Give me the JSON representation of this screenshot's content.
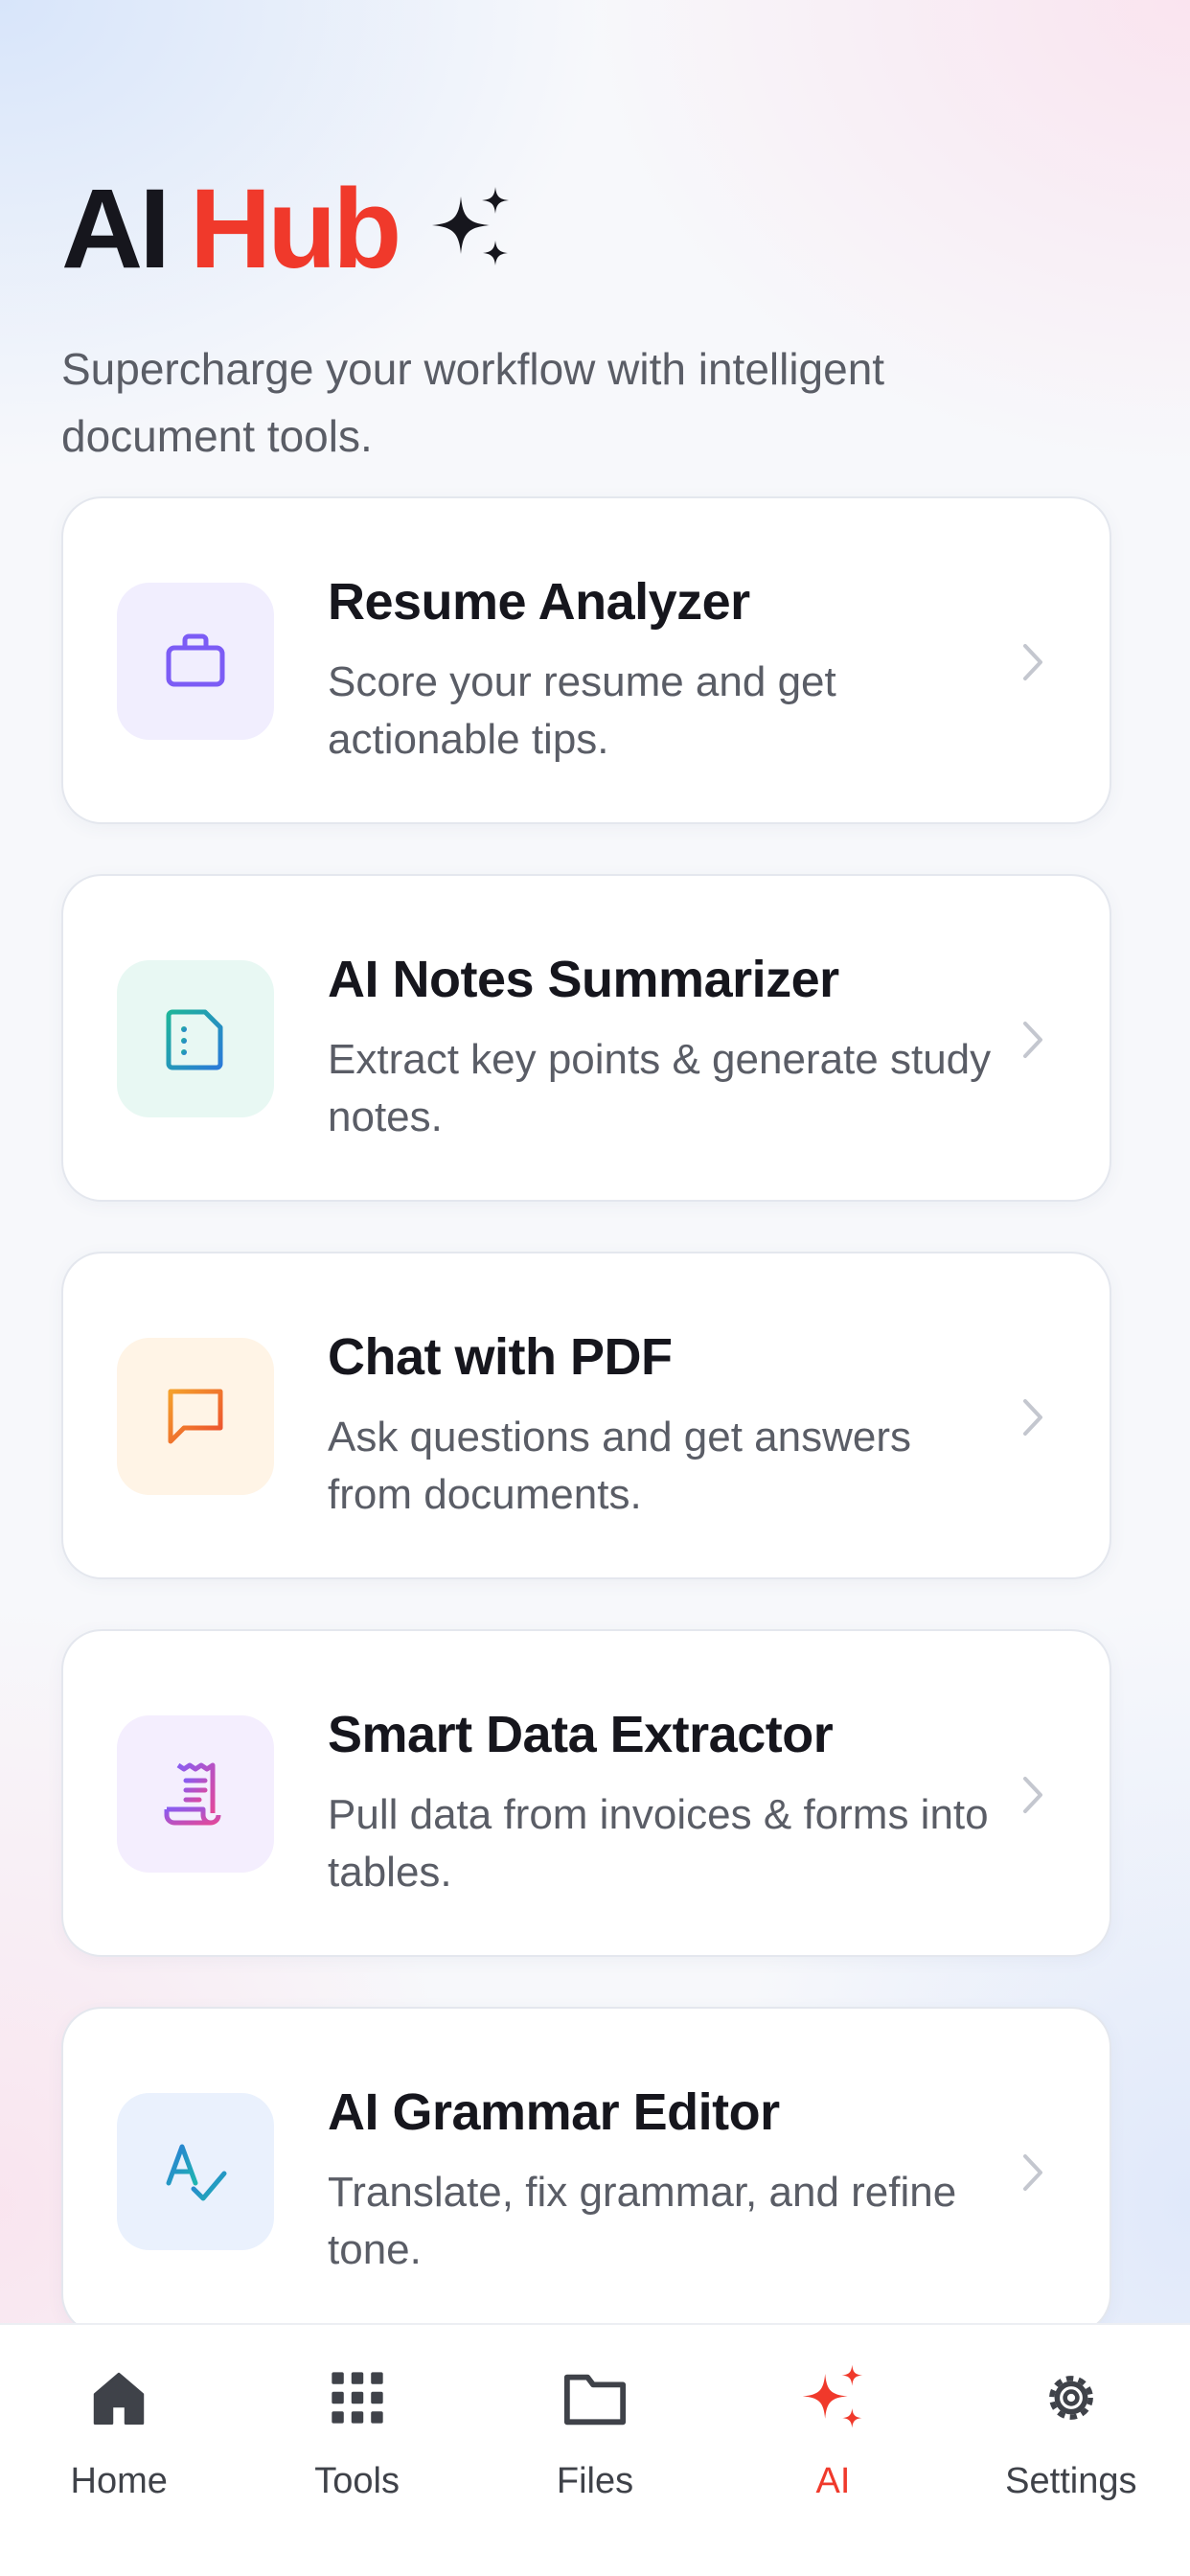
{
  "header": {
    "title_part1": "AI",
    "title_part2": "Hub",
    "title_icon": "sparkles-icon",
    "subtitle": "Supercharge your workflow with intelligent document tools."
  },
  "tools": [
    {
      "title": "Resume Analyzer",
      "description": "Score your resume and get actionable tips.",
      "icon": "briefcase-icon",
      "icon_color": "#7c5cf5",
      "bg_color": "#f1eefe"
    },
    {
      "title": "AI Notes Summarizer",
      "description": "Extract key points & generate study notes.",
      "icon": "notes-document-icon",
      "icon_color": "#1a9ab3",
      "bg_color": "#e8f8f3"
    },
    {
      "title": "Chat with PDF",
      "description": "Ask questions and get answers from documents.",
      "icon": "chat-bubble-icon",
      "icon_color": "#ef6a2d",
      "bg_color": "#fff4e6"
    },
    {
      "title": "Smart Data Extractor",
      "description": "Pull data from invoices & forms into tables.",
      "icon": "receipt-icon",
      "icon_color": "#b54ed0",
      "bg_color": "#f4eefe"
    },
    {
      "title": "AI Grammar Editor",
      "description": "Translate, fix grammar, and refine tone.",
      "icon": "spell-check-icon",
      "icon_color": "#2f86e8",
      "bg_color": "#eaf1fd"
    }
  ],
  "tabbar": {
    "items": [
      {
        "label": "Home",
        "icon": "home-icon",
        "active": false
      },
      {
        "label": "Tools",
        "icon": "grid-icon",
        "active": false
      },
      {
        "label": "Files",
        "icon": "folder-icon",
        "active": false
      },
      {
        "label": "AI",
        "icon": "sparkles-icon",
        "active": true
      },
      {
        "label": "Settings",
        "icon": "gear-icon",
        "active": false
      }
    ]
  },
  "colors": {
    "accent": "#f0392b",
    "text_primary": "#16161d",
    "text_secondary": "#5a5d66",
    "tab_inactive": "#3f4249"
  }
}
